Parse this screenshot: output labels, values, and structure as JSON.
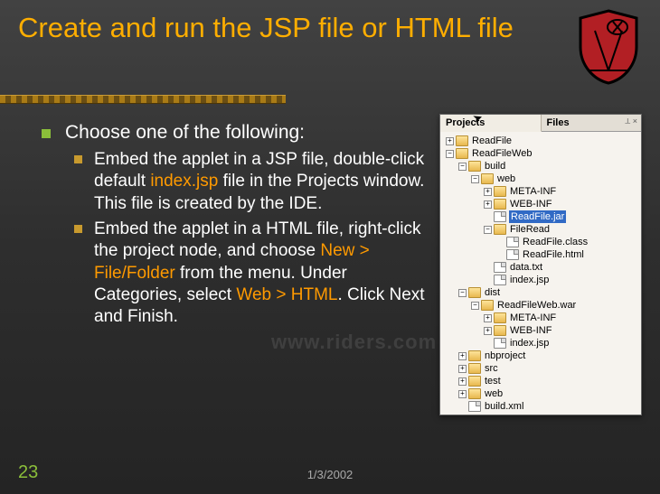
{
  "title": "Create and run the JSP file or HTML file",
  "body": {
    "lead": "Choose one of the following:",
    "sub1_plain1": "Embed the applet in a JSP file, double-click default ",
    "sub1_accent1": "index.jsp",
    "sub1_plain2": " file in the Projects window. This file is created by the IDE.",
    "sub2_plain1": "Embed the applet in a HTML file, right-click the project node, and choose ",
    "sub2_accent1": "New > File/Folder",
    "sub2_plain2": " from the menu. Under Categories, select ",
    "sub2_accent2": "Web > HTML",
    "sub2_plain3": ". Click Next and Finish."
  },
  "footer": {
    "number": "23",
    "date": "1/3/2002"
  },
  "watermark": "www.riders.com",
  "panel": {
    "tab1": "Projects",
    "tab2": "Files"
  },
  "tree": [
    {
      "depth": 0,
      "tgl": "+",
      "icon": "fld",
      "label": "ReadFile"
    },
    {
      "depth": 0,
      "tgl": "-",
      "icon": "fld",
      "label": "ReadFileWeb"
    },
    {
      "depth": 1,
      "tgl": "-",
      "icon": "fld",
      "label": "build"
    },
    {
      "depth": 2,
      "tgl": "-",
      "icon": "fld",
      "label": "web"
    },
    {
      "depth": 3,
      "tgl": "+",
      "icon": "fld",
      "label": "META-INF"
    },
    {
      "depth": 3,
      "tgl": "+",
      "icon": "fld",
      "label": "WEB-INF"
    },
    {
      "depth": 3,
      "tgl": " ",
      "icon": "file",
      "label": "ReadFile.jar",
      "selected": true
    },
    {
      "depth": 3,
      "tgl": "-",
      "icon": "fld",
      "label": "FileRead"
    },
    {
      "depth": 4,
      "tgl": " ",
      "icon": "file",
      "label": "ReadFile.class"
    },
    {
      "depth": 4,
      "tgl": " ",
      "icon": "file",
      "label": "ReadFile.html"
    },
    {
      "depth": 3,
      "tgl": " ",
      "icon": "file",
      "label": "data.txt"
    },
    {
      "depth": 3,
      "tgl": " ",
      "icon": "file",
      "label": "index.jsp"
    },
    {
      "depth": 1,
      "tgl": "-",
      "icon": "fld",
      "label": "dist"
    },
    {
      "depth": 2,
      "tgl": "-",
      "icon": "fld",
      "label": "ReadFileWeb.war"
    },
    {
      "depth": 3,
      "tgl": "+",
      "icon": "fld",
      "label": "META-INF"
    },
    {
      "depth": 3,
      "tgl": "+",
      "icon": "fld",
      "label": "WEB-INF"
    },
    {
      "depth": 3,
      "tgl": " ",
      "icon": "file",
      "label": "index.jsp"
    },
    {
      "depth": 1,
      "tgl": "+",
      "icon": "fld",
      "label": "nbproject"
    },
    {
      "depth": 1,
      "tgl": "+",
      "icon": "fld",
      "label": "src"
    },
    {
      "depth": 1,
      "tgl": "+",
      "icon": "fld",
      "label": "test"
    },
    {
      "depth": 1,
      "tgl": "+",
      "icon": "fld",
      "label": "web"
    },
    {
      "depth": 1,
      "tgl": " ",
      "icon": "file",
      "label": "build.xml"
    }
  ]
}
